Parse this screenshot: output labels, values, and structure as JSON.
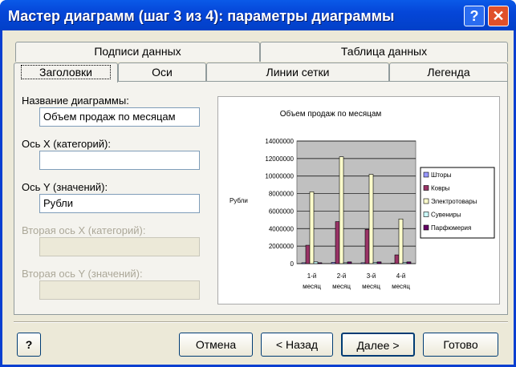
{
  "window": {
    "title": "Мастер диаграмм (шаг 3 из 4): параметры диаграммы",
    "help_label": "?",
    "close_label": "✕"
  },
  "tabs": {
    "row1": [
      "Подписи данных",
      "Таблица данных"
    ],
    "row2": [
      "Заголовки",
      "Оси",
      "Линии сетки",
      "Легенда"
    ],
    "active": "Заголовки"
  },
  "fields": {
    "chart_title": {
      "label": "Название диаграммы:",
      "value": "Объем продаж по месяцам"
    },
    "x_axis": {
      "label": "Ось X (категорий):",
      "value": ""
    },
    "y_axis": {
      "label": "Ось Y (значений):",
      "value": "Рубли"
    },
    "x2_axis": {
      "label": "Вторая ось X (категорий):",
      "value": ""
    },
    "y2_axis": {
      "label": "Вторая ось Y (значений):",
      "value": ""
    }
  },
  "buttons": {
    "help": "?",
    "cancel": "Отмена",
    "back": "< Назад",
    "next": "Далее >",
    "finish": "Готово"
  },
  "chart_data": {
    "type": "bar",
    "title": "Объем продаж по месяцам",
    "xlabel": "",
    "ylabel": "Рубли",
    "ylim": [
      0,
      14000000
    ],
    "yticks": [
      "0",
      "2000000",
      "4000000",
      "6000000",
      "8000000",
      "10000000",
      "12000000",
      "14000000"
    ],
    "categories": [
      [
        "1-й",
        "месяц"
      ],
      [
        "2-й",
        "месяц"
      ],
      [
        "3-й",
        "месяц"
      ],
      [
        "4-й",
        "месяц"
      ]
    ],
    "legend_position": "right",
    "series": [
      {
        "name": "Шторы",
        "color": "#9999ff",
        "values": [
          100000,
          150000,
          100000,
          50000
        ]
      },
      {
        "name": "Ковры",
        "color": "#993366",
        "values": [
          2100000,
          4800000,
          3900000,
          1000000
        ]
      },
      {
        "name": "Электротовары",
        "color": "#ffffcc",
        "values": [
          8200000,
          12200000,
          10200000,
          5100000
        ]
      },
      {
        "name": "Сувениры",
        "color": "#ccffff",
        "values": [
          200000,
          100000,
          150000,
          150000
        ]
      },
      {
        "name": "Парфюмерия",
        "color": "#660066",
        "values": [
          100000,
          200000,
          200000,
          200000
        ]
      }
    ]
  }
}
